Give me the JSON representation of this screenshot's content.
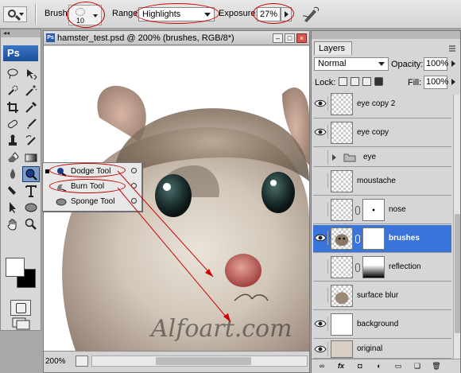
{
  "options_bar": {
    "brush_label": "Brush:",
    "brush_size": "10",
    "range_label": "Range:",
    "range_value": "Highlights",
    "exposure_label": "Exposure:",
    "exposure_value": "27%"
  },
  "tools_panel": {
    "logo": "Ps",
    "flyout": [
      {
        "label": "Dodge Tool",
        "icon": "dodge-icon",
        "selected": true
      },
      {
        "label": "Burn Tool",
        "icon": "burn-icon",
        "selected": false
      },
      {
        "label": "Sponge Tool",
        "icon": "sponge-icon",
        "selected": false
      }
    ]
  },
  "document": {
    "title": "hamster_test.psd @ 200% (brushes, RGB/8*)",
    "zoom": "200%"
  },
  "layers_panel": {
    "tab": "Layers",
    "blend_mode": "Normal",
    "opacity_label": "Opacity:",
    "opacity_value": "100%",
    "lock_label": "Lock:",
    "fill_label": "Fill:",
    "fill_value": "100%",
    "layers": [
      {
        "name": "eye copy 2",
        "visible": true,
        "type": "layer"
      },
      {
        "name": "eye copy",
        "visible": true,
        "type": "layer"
      },
      {
        "name": "eye",
        "visible": false,
        "type": "group"
      },
      {
        "name": "moustache",
        "visible": false,
        "type": "layer"
      },
      {
        "name": "nose",
        "visible": false,
        "type": "masked"
      },
      {
        "name": "brushes",
        "visible": true,
        "type": "masked",
        "selected": true
      },
      {
        "name": "reflection",
        "visible": false,
        "type": "masked"
      },
      {
        "name": "surface blur",
        "visible": false,
        "type": "layer"
      },
      {
        "name": "background",
        "visible": true,
        "type": "layer"
      },
      {
        "name": "original",
        "visible": true,
        "type": "layer"
      }
    ]
  },
  "watermark": "Alfoart.com",
  "colors": {
    "accent": "#3a73d9",
    "annotation": "#cc0000"
  }
}
